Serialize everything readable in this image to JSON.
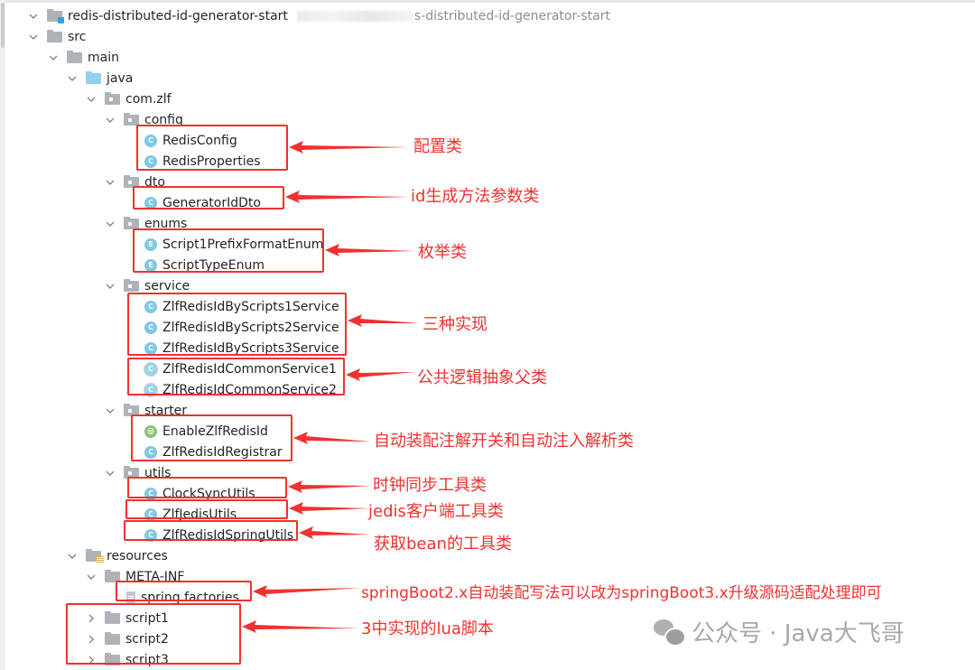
{
  "project": {
    "name": "redis-distributed-id-generator-start",
    "path_suffix": "s-distributed-id-generator-start"
  },
  "tree": {
    "src": "src",
    "main": "main",
    "java": "java",
    "package": "com.zlf",
    "config": {
      "name": "config",
      "files": [
        "RedisConfig",
        "RedisProperties"
      ]
    },
    "dto": {
      "name": "dto",
      "files": [
        "GeneratorIdDto"
      ]
    },
    "enums": {
      "name": "enums",
      "files": [
        "Script1PrefixFormatEnum",
        "ScriptTypeEnum"
      ]
    },
    "service": {
      "name": "service",
      "files": [
        "ZlfRedisIdByScripts1Service",
        "ZlfRedisIdByScripts2Service",
        "ZlfRedisIdByScripts3Service"
      ],
      "abstract_files": [
        "ZlfRedisIdCommonService1",
        "ZlfRedisIdCommonService2"
      ]
    },
    "starter": {
      "name": "starter",
      "annotation": "EnableZlfRedisId",
      "files": [
        "ZlfRedisIdRegistrar"
      ]
    },
    "utils": {
      "name": "utils",
      "files": [
        "ClockSyncUtils",
        "ZlfJedisUtils",
        "ZlfRedisIdSpringUtils"
      ]
    },
    "resources": "resources",
    "meta_inf": "META-INF",
    "spring_factories": "spring.factories",
    "scripts": [
      "script1",
      "script2",
      "script3"
    ]
  },
  "icons": {
    "class": "C",
    "enum": "E",
    "annotation": "@"
  },
  "annotations": {
    "config": "配置类",
    "dto": "id生成方法参数类",
    "enums": "枚举类",
    "service_impl": "三种实现",
    "service_abstract": "公共逻辑抽象父类",
    "starter": "自动装配注解开关和自动注入解析类",
    "clock": "时钟同步工具类",
    "jedis": "jedis客户端工具类",
    "spring_utils": "获取bean的工具类",
    "factories": "springBoot2.x自动装配写法可以改为springBoot3.x升级源码适配处理即可",
    "scripts": "3中实现的lua脚本"
  },
  "watermark": {
    "text": "公众号 · Java大飞哥"
  },
  "colors": {
    "annotation_red": "#f0312f",
    "class_icon": "#7ec8e3",
    "annotation_icon": "#8ac178",
    "source_folder": "#8fd0ea"
  }
}
